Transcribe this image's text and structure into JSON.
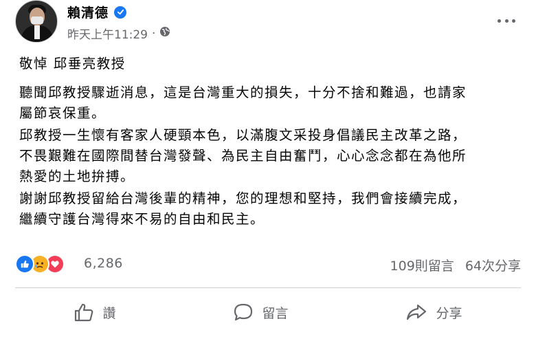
{
  "post": {
    "author": "賴清德",
    "timestamp": "昨天上午11:29",
    "separator": "·",
    "paragraphs": [
      [
        "敬悼 邱垂亮教授"
      ],
      [
        "聽聞邱教授驟逝消息，這是台灣重大的損失，十分不捨和難過，也請家",
        "屬節哀保重。"
      ],
      [
        "邱教授一生懷有客家人硬頸本色，以滿腹文采投身倡議民主改革之路，",
        "不畏艱難在國際間替台灣發聲、為民主自由奮鬥，心心念念都在為他所",
        "熱愛的土地拚搏。"
      ],
      [
        "謝謝邱教授留給台灣後輩的精神，您的理想和堅持，我們會接續完成，",
        "繼續守護台灣得來不易的自由和民主。"
      ]
    ]
  },
  "stats": {
    "reaction_icons": [
      "like-icon",
      "sad-icon",
      "love-icon"
    ],
    "reaction_count": "6,286",
    "comments": "109則留言",
    "shares": "64次分享"
  },
  "actions": {
    "like_label": "讚",
    "comment_label": "留言",
    "share_label": "分享"
  },
  "colors": {
    "brand_blue": "#1877f2",
    "secondary_text": "#65676b",
    "love_red": "#f33e58",
    "sad_yellow": "#f7b125"
  }
}
